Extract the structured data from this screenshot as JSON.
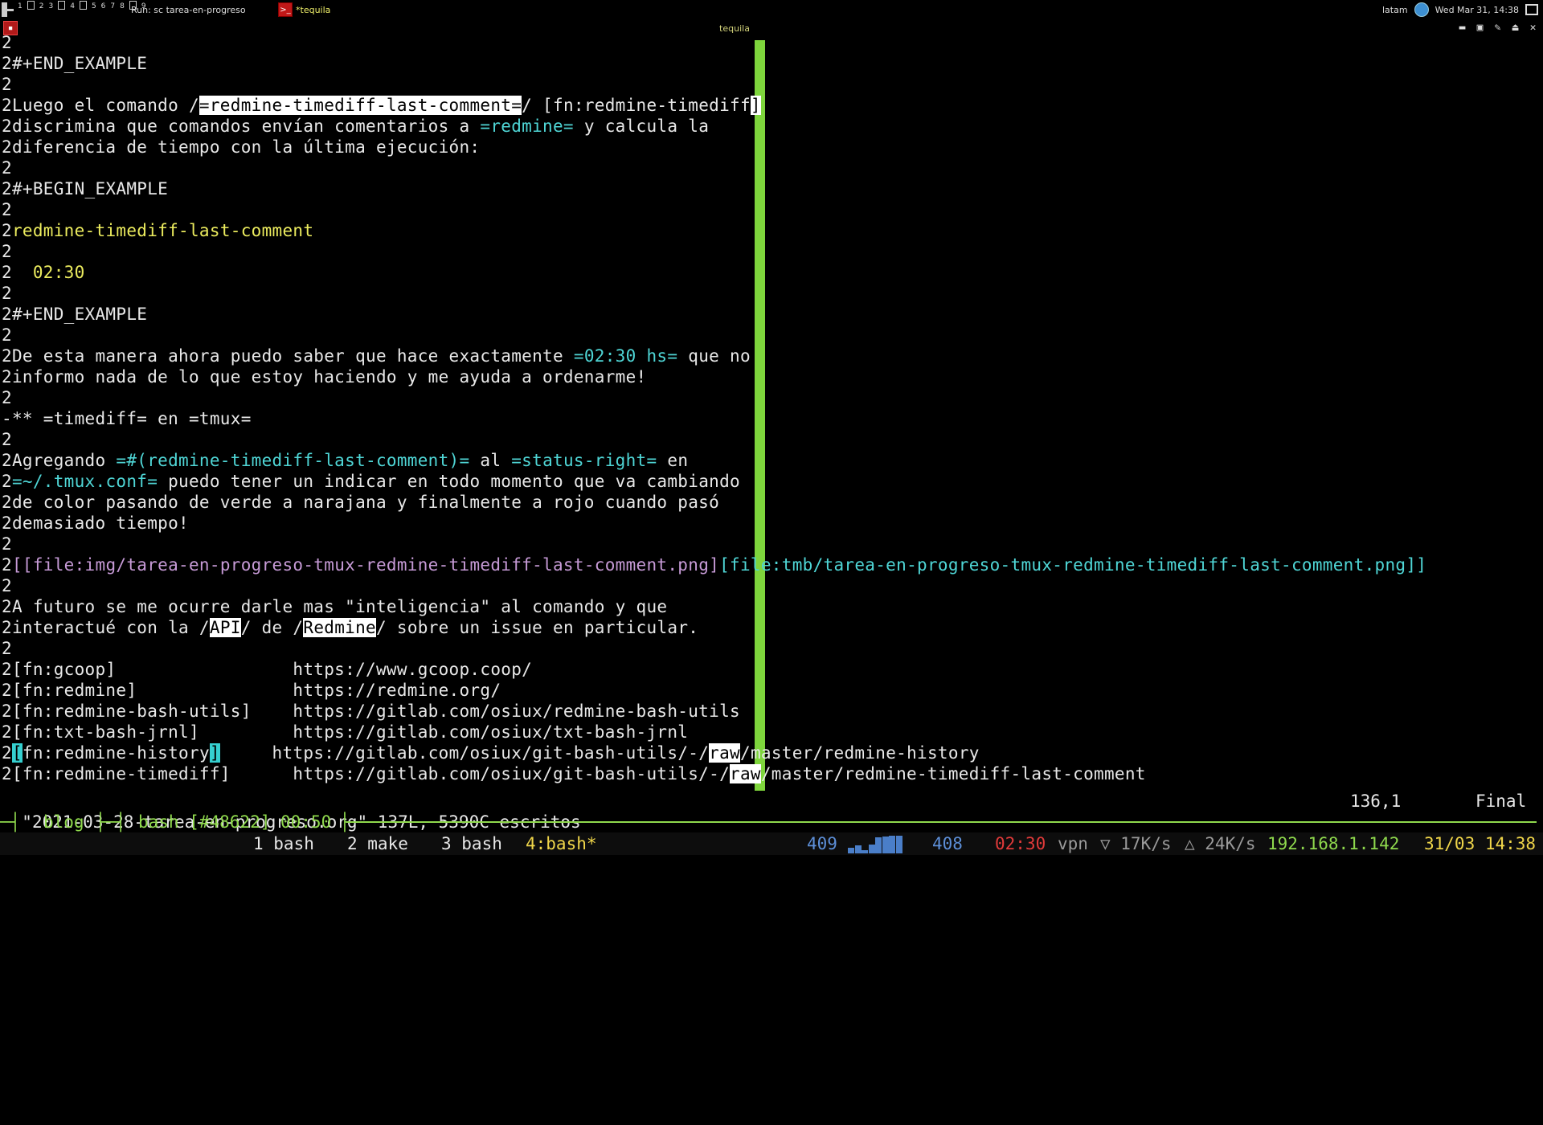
{
  "wm": {
    "workspaces": [
      "1",
      "",
      "2",
      "3",
      "",
      "4",
      "",
      "5",
      "6",
      "7",
      "8",
      "",
      "9"
    ],
    "run_label": "Run: sc tarea-en-progreso",
    "task_title": "*tequila",
    "locale": "latam",
    "clock": "Wed Mar 31, 14:38"
  },
  "window": {
    "title": "tequila"
  },
  "editor": {
    "lines": [
      [
        {
          "t": "2"
        }
      ],
      [
        {
          "t": "2"
        },
        {
          "t": "#+END_EXAMPLE",
          "c": "g"
        }
      ],
      [
        {
          "t": "2"
        }
      ],
      [
        {
          "t": "2Luego el comando /"
        },
        {
          "t": "=redmine-timediff-last-comment=",
          "c": "sel"
        },
        {
          "t": "/ [fn:redmine-timediff"
        },
        {
          "t": "]",
          "c": "sel"
        }
      ],
      [
        {
          "t": "2discrimina que comandos envían comentarios a "
        },
        {
          "t": "=redmine=",
          "c": "cyan"
        },
        {
          "t": " y calcula la"
        }
      ],
      [
        {
          "t": "2diferencia de tiempo con la última ejecución:"
        }
      ],
      [
        {
          "t": "2"
        }
      ],
      [
        {
          "t": "2#+BEGIN_EXAMPLE"
        }
      ],
      [
        {
          "t": "2"
        }
      ],
      [
        {
          "t": "2"
        },
        {
          "t": "redmine-timediff-last-comment",
          "c": "yellow"
        }
      ],
      [
        {
          "t": "2"
        }
      ],
      [
        {
          "t": "2  "
        },
        {
          "t": "02:30",
          "c": "yellow"
        }
      ],
      [
        {
          "t": "2"
        }
      ],
      [
        {
          "t": "2#+END_EXAMPLE"
        }
      ],
      [
        {
          "t": "2"
        }
      ],
      [
        {
          "t": "2De esta manera ahora puedo saber que hace exactamente "
        },
        {
          "t": "=02:30 hs=",
          "c": "cyan"
        },
        {
          "t": " que no"
        }
      ],
      [
        {
          "t": "2informo nada de lo que estoy haciendo y me ayuda a ordenarme!"
        }
      ],
      [
        {
          "t": "2"
        }
      ],
      [
        {
          "t": "-** =timediff= en =tmux="
        }
      ],
      [
        {
          "t": "2"
        }
      ],
      [
        {
          "t": "2Agregando "
        },
        {
          "t": "=#(redmine-timediff-last-comment)=",
          "c": "cyan"
        },
        {
          "t": " al "
        },
        {
          "t": "=status-right=",
          "c": "cyan"
        },
        {
          "t": " en"
        }
      ],
      [
        {
          "t": "2"
        },
        {
          "t": "=~/.tmux.conf=",
          "c": "cyan"
        },
        {
          "t": " puedo tener un indicar en todo momento que va cambiando"
        }
      ],
      [
        {
          "t": "2de color pasando de verde a narajana y finalmente a rojo cuando pasó"
        }
      ],
      [
        {
          "t": "2demasiado tiempo!"
        }
      ],
      [
        {
          "t": "2"
        }
      ],
      [
        {
          "t": "2"
        },
        {
          "t": "[[file:img/tarea-en-progreso-tmux-redmine-timediff-last-comment.png]",
          "c": "purple"
        },
        {
          "t": "[file:tmb/tarea-en-progreso-tmux-redmine-timediff-last-comment.png]]",
          "c": "cyan"
        }
      ],
      [
        {
          "t": "2"
        }
      ],
      [
        {
          "t": "2A futuro se me ocurre darle mas \"inteligencia\" al comando y que"
        }
      ],
      [
        {
          "t": "2interactué con la /"
        },
        {
          "t": "API",
          "c": "sel"
        },
        {
          "t": "/ de /"
        },
        {
          "t": "Redmine",
          "c": "sel"
        },
        {
          "t": "/ sobre un issue en particular."
        }
      ],
      [
        {
          "t": "2"
        }
      ],
      [
        {
          "t": "2[fn:gcoop]                 https://www.gcoop.coop/"
        }
      ],
      [
        {
          "t": "2[fn:redmine]               https://redmine.org/"
        }
      ],
      [
        {
          "t": "2[fn:redmine-bash-utils]    https://gitlab.com/osiux/redmine-bash-utils"
        }
      ],
      [
        {
          "t": "2[fn:txt-bash-jrnl]         https://gitlab.com/osiux/txt-bash-jrnl"
        }
      ],
      [
        {
          "t": "2"
        },
        {
          "t": "[",
          "c": "cur"
        },
        {
          "t": "fn:redmine-history"
        },
        {
          "t": "]",
          "c": "cur"
        },
        {
          "t": "     https://gitlab.com/osiux/git-bash-utils/-/"
        },
        {
          "t": "raw",
          "c": "sel"
        },
        {
          "t": "/master/redmine-history"
        }
      ],
      [
        {
          "t": "2[fn:redmine-timediff]      https://gitlab.com/osiux/git-bash-utils/-/"
        },
        {
          "t": "raw",
          "c": "sel"
        },
        {
          "t": "/master/redmine-timediff-last-comment"
        }
      ]
    ],
    "status_msg": "\"2021-03-28-tarea-en-progreso.org\" 137L, 5390C escritos",
    "cursor_pos": "136,1",
    "scroll_pos": "Final"
  },
  "tmux": {
    "session_prefix": "─┤ ",
    "session": "blog",
    "session_sep": " ├─┤ ",
    "pane": "bash [#48622] 00:50",
    "pane_suffix": " ├",
    "windows": [
      "1 bash",
      "2 make",
      "3 bash"
    ],
    "active_window": "4:bash*",
    "load_a": "409",
    "load_b": "408",
    "timediff": "02:30",
    "vpn": "vpn",
    "down": "▽ 17K/s",
    "up": "△ 24K/s",
    "ip": "192.168.1.142",
    "date": "31/03 14:38",
    "spark": [
      0.3,
      0.45,
      0.2,
      0.5,
      0.9,
      0.95,
      1.0,
      1.0
    ],
    "colors": {
      "accent": "#8fd94d",
      "load": "#5d8fd8",
      "alert": "#e03a3a",
      "active": "#f0d64a"
    }
  }
}
